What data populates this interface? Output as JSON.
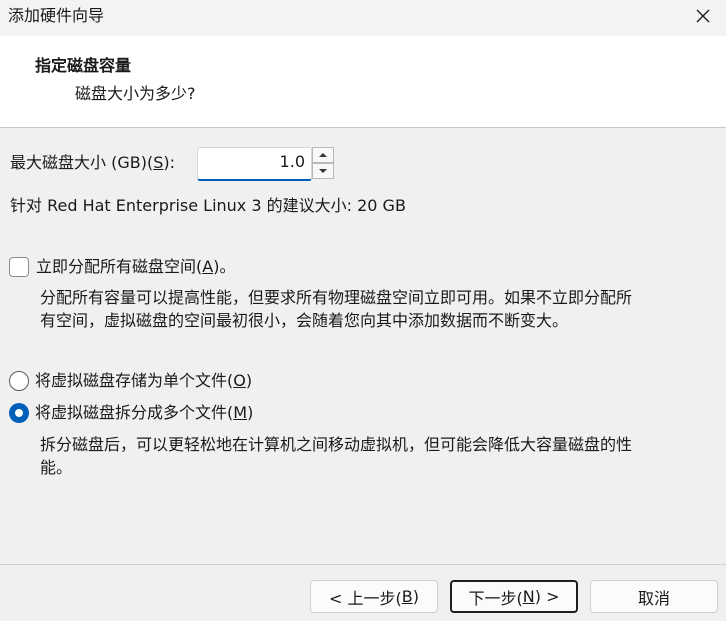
{
  "window": {
    "title": "添加硬件向导"
  },
  "header": {
    "title": "指定磁盘容量",
    "subtitle": "磁盘大小为多少?"
  },
  "disk_size": {
    "label_pre": "最大磁盘大小 (GB)(",
    "label_key": "S",
    "label_post": "):",
    "value": "1.0"
  },
  "recommendation": "针对 Red Hat Enterprise Linux 3 的建议大小: 20 GB",
  "allocate": {
    "label_pre": "立即分配所有磁盘空间(",
    "label_key": "A",
    "label_post": ")。",
    "checked": false,
    "desc_line1": "分配所有容量可以提高性能，但要求所有物理磁盘空间立即可用。如果不立即分配所",
    "desc_line2": "有空间，虚拟磁盘的空间最初很小，会随着您向其中添加数据而不断变大。"
  },
  "storage": {
    "single": {
      "label_pre": "将虚拟磁盘存储为单个文件(",
      "label_key": "O",
      "label_post": ")",
      "selected": false
    },
    "multiple": {
      "label_pre": "将虚拟磁盘拆分成多个文件(",
      "label_key": "M",
      "label_post": ")",
      "selected": true,
      "desc_line1": "拆分磁盘后，可以更轻松地在计算机之间移动虚拟机，但可能会降低大容量磁盘的性",
      "desc_line2": "能。"
    }
  },
  "buttons": {
    "back": {
      "pre": "< 上一步(",
      "key": "B",
      "post": ")"
    },
    "next": {
      "pre": "下一步(",
      "key": "N",
      "post": ") >"
    },
    "cancel": "取消"
  },
  "colors": {
    "accent": "#005fb8",
    "background": "#f0f0f0",
    "header_bg": "#ffffff"
  }
}
